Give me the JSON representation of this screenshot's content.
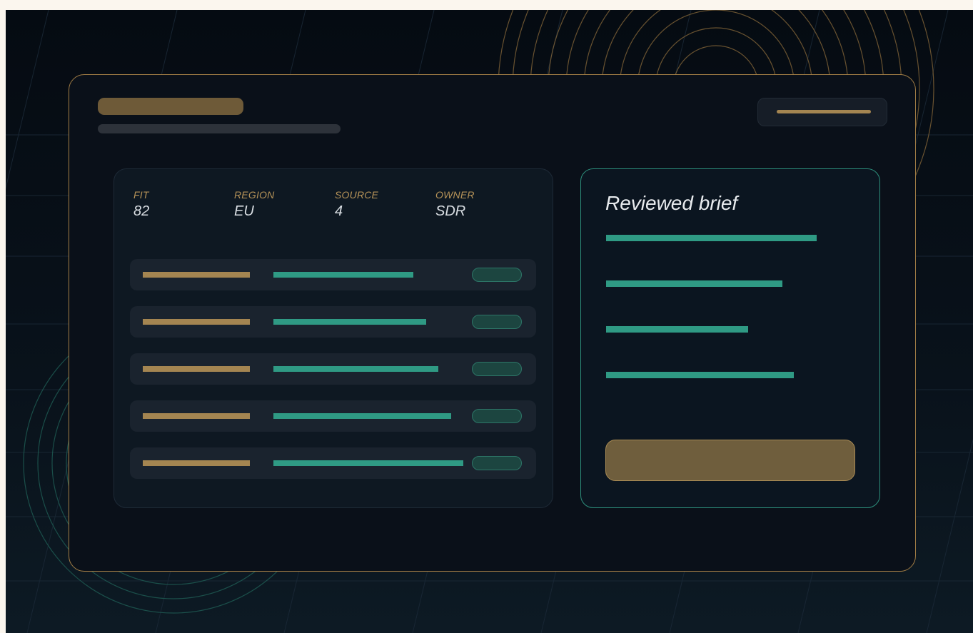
{
  "colors": {
    "accent_gold": "#a48551",
    "accent_teal": "#2f9a84",
    "background": "#060c13",
    "panel": "#0e1822"
  },
  "metrics": [
    {
      "label": "FIT",
      "value": "82"
    },
    {
      "label": "REGION",
      "value": "EU"
    },
    {
      "label": "SOURCE",
      "value": "4"
    },
    {
      "label": "OWNER",
      "value": "SDR"
    }
  ],
  "brief": {
    "title": "Reviewed brief"
  }
}
